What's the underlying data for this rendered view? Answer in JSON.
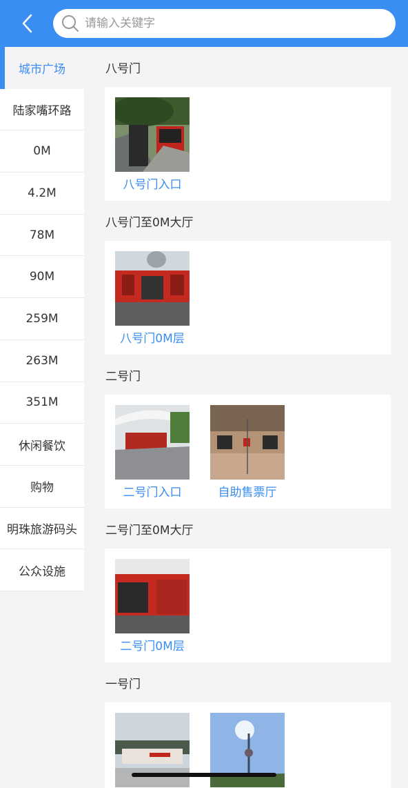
{
  "search": {
    "placeholder": "请输入关键字"
  },
  "sidebar": {
    "items": [
      {
        "label": "城市广场",
        "active": true
      },
      {
        "label": "陆家嘴环路"
      },
      {
        "label": "0M"
      },
      {
        "label": "4.2M"
      },
      {
        "label": "78M"
      },
      {
        "label": "90M"
      },
      {
        "label": "259M"
      },
      {
        "label": "263M"
      },
      {
        "label": "351M"
      },
      {
        "label": "休闲餐饮"
      },
      {
        "label": "购物"
      },
      {
        "label": "明珠旅游码头"
      },
      {
        "label": "公众设施"
      }
    ]
  },
  "sections": [
    {
      "title": "八号门",
      "items": [
        {
          "caption": "八号门入口"
        }
      ]
    },
    {
      "title": "八号门至0M大厅",
      "items": [
        {
          "caption": "八号门0M层"
        }
      ]
    },
    {
      "title": "二号门",
      "items": [
        {
          "caption": "二号门入口"
        },
        {
          "caption": "自助售票厅"
        }
      ]
    },
    {
      "title": "二号门至0M大厅",
      "items": [
        {
          "caption": "二号门0M层"
        }
      ]
    },
    {
      "title": "一号门",
      "items": [
        {
          "caption": ""
        },
        {
          "caption": ""
        }
      ]
    }
  ],
  "colors": {
    "accent": "#3a8ef2",
    "background": "#f4f4f7"
  }
}
